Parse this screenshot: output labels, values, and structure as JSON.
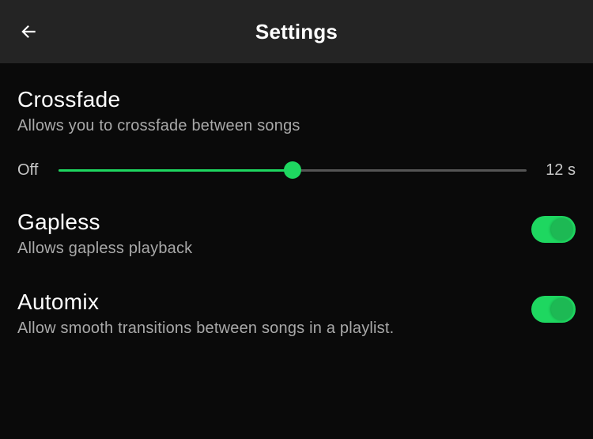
{
  "header": {
    "title": "Settings"
  },
  "crossfade": {
    "title": "Crossfade",
    "description": "Allows you to crossfade between songs",
    "slider": {
      "left_label": "Off",
      "right_label": "12 s",
      "value_percent": 50
    }
  },
  "gapless": {
    "title": "Gapless",
    "description": "Allows gapless playback",
    "enabled": true
  },
  "automix": {
    "title": "Automix",
    "description": "Allow smooth transitions between songs in a playlist.",
    "enabled": true
  },
  "colors": {
    "accent": "#1ed760"
  }
}
